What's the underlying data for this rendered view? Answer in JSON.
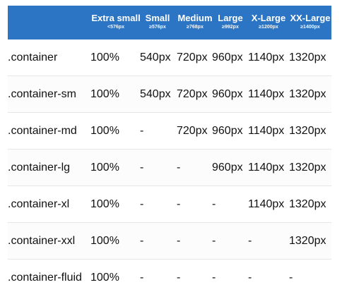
{
  "header": {
    "columns": [
      {
        "size": "Extra small",
        "breakpoint": "<576px"
      },
      {
        "size": "Small",
        "breakpoint": "≥576px"
      },
      {
        "size": "Medium",
        "breakpoint": "≥768px"
      },
      {
        "size": "Large",
        "breakpoint": "≥992px"
      },
      {
        "size": "X-Large",
        "breakpoint": "≥1200px"
      },
      {
        "size": "XX-Large",
        "breakpoint": "≥1400px"
      }
    ]
  },
  "rows": [
    {
      "label": ".container",
      "values": [
        "100%",
        "540px",
        "720px",
        "960px",
        "1140px",
        "1320px"
      ]
    },
    {
      "label": ".container-sm",
      "values": [
        "100%",
        "540px",
        "720px",
        "960px",
        "1140px",
        "1320px"
      ]
    },
    {
      "label": ".container-md",
      "values": [
        "100%",
        "-",
        "720px",
        "960px",
        "1140px",
        "1320px"
      ]
    },
    {
      "label": ".container-lg",
      "values": [
        "100%",
        "-",
        "-",
        "960px",
        "1140px",
        "1320px"
      ]
    },
    {
      "label": ".container-xl",
      "values": [
        "100%",
        "-",
        "-",
        "-",
        "1140px",
        "1320px"
      ]
    },
    {
      "label": ".container-xxl",
      "values": [
        "100%",
        "-",
        "-",
        "-",
        "-",
        "1320px"
      ]
    },
    {
      "label": ".container-fluid",
      "values": [
        "100%",
        "-",
        "-",
        "-",
        "-",
        "-"
      ]
    }
  ],
  "colors": {
    "header_bg": "#2b75c4",
    "header_text": "#ffffff",
    "body_text": "#111111"
  }
}
